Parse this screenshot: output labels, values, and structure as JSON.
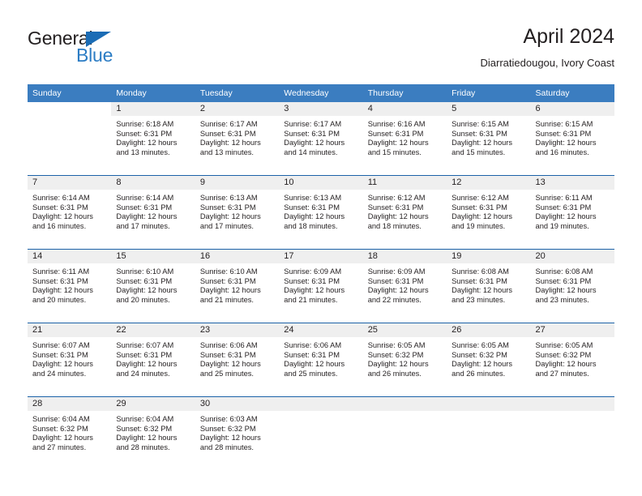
{
  "brand": {
    "name_dark": "General",
    "name_light": "Blue"
  },
  "header": {
    "title": "April 2024",
    "subtitle": "Diarratiedougou, Ivory Coast"
  },
  "colors": {
    "header_blue": "#3b7dc0",
    "rule_blue": "#1b62a8",
    "daynum_band": "#efefef",
    "logo_blue": "#2b7cc4",
    "text": "#231f20"
  },
  "weekday_headers": [
    "Sunday",
    "Monday",
    "Tuesday",
    "Wednesday",
    "Thursday",
    "Friday",
    "Saturday"
  ],
  "weeks": [
    [
      {
        "day": "",
        "lines": []
      },
      {
        "day": "1",
        "lines": [
          "Sunrise: 6:18 AM",
          "Sunset: 6:31 PM",
          "Daylight: 12 hours",
          "and 13 minutes."
        ]
      },
      {
        "day": "2",
        "lines": [
          "Sunrise: 6:17 AM",
          "Sunset: 6:31 PM",
          "Daylight: 12 hours",
          "and 13 minutes."
        ]
      },
      {
        "day": "3",
        "lines": [
          "Sunrise: 6:17 AM",
          "Sunset: 6:31 PM",
          "Daylight: 12 hours",
          "and 14 minutes."
        ]
      },
      {
        "day": "4",
        "lines": [
          "Sunrise: 6:16 AM",
          "Sunset: 6:31 PM",
          "Daylight: 12 hours",
          "and 15 minutes."
        ]
      },
      {
        "day": "5",
        "lines": [
          "Sunrise: 6:15 AM",
          "Sunset: 6:31 PM",
          "Daylight: 12 hours",
          "and 15 minutes."
        ]
      },
      {
        "day": "6",
        "lines": [
          "Sunrise: 6:15 AM",
          "Sunset: 6:31 PM",
          "Daylight: 12 hours",
          "and 16 minutes."
        ]
      }
    ],
    [
      {
        "day": "7",
        "lines": [
          "Sunrise: 6:14 AM",
          "Sunset: 6:31 PM",
          "Daylight: 12 hours",
          "and 16 minutes."
        ]
      },
      {
        "day": "8",
        "lines": [
          "Sunrise: 6:14 AM",
          "Sunset: 6:31 PM",
          "Daylight: 12 hours",
          "and 17 minutes."
        ]
      },
      {
        "day": "9",
        "lines": [
          "Sunrise: 6:13 AM",
          "Sunset: 6:31 PM",
          "Daylight: 12 hours",
          "and 17 minutes."
        ]
      },
      {
        "day": "10",
        "lines": [
          "Sunrise: 6:13 AM",
          "Sunset: 6:31 PM",
          "Daylight: 12 hours",
          "and 18 minutes."
        ]
      },
      {
        "day": "11",
        "lines": [
          "Sunrise: 6:12 AM",
          "Sunset: 6:31 PM",
          "Daylight: 12 hours",
          "and 18 minutes."
        ]
      },
      {
        "day": "12",
        "lines": [
          "Sunrise: 6:12 AM",
          "Sunset: 6:31 PM",
          "Daylight: 12 hours",
          "and 19 minutes."
        ]
      },
      {
        "day": "13",
        "lines": [
          "Sunrise: 6:11 AM",
          "Sunset: 6:31 PM",
          "Daylight: 12 hours",
          "and 19 minutes."
        ]
      }
    ],
    [
      {
        "day": "14",
        "lines": [
          "Sunrise: 6:11 AM",
          "Sunset: 6:31 PM",
          "Daylight: 12 hours",
          "and 20 minutes."
        ]
      },
      {
        "day": "15",
        "lines": [
          "Sunrise: 6:10 AM",
          "Sunset: 6:31 PM",
          "Daylight: 12 hours",
          "and 20 minutes."
        ]
      },
      {
        "day": "16",
        "lines": [
          "Sunrise: 6:10 AM",
          "Sunset: 6:31 PM",
          "Daylight: 12 hours",
          "and 21 minutes."
        ]
      },
      {
        "day": "17",
        "lines": [
          "Sunrise: 6:09 AM",
          "Sunset: 6:31 PM",
          "Daylight: 12 hours",
          "and 21 minutes."
        ]
      },
      {
        "day": "18",
        "lines": [
          "Sunrise: 6:09 AM",
          "Sunset: 6:31 PM",
          "Daylight: 12 hours",
          "and 22 minutes."
        ]
      },
      {
        "day": "19",
        "lines": [
          "Sunrise: 6:08 AM",
          "Sunset: 6:31 PM",
          "Daylight: 12 hours",
          "and 23 minutes."
        ]
      },
      {
        "day": "20",
        "lines": [
          "Sunrise: 6:08 AM",
          "Sunset: 6:31 PM",
          "Daylight: 12 hours",
          "and 23 minutes."
        ]
      }
    ],
    [
      {
        "day": "21",
        "lines": [
          "Sunrise: 6:07 AM",
          "Sunset: 6:31 PM",
          "Daylight: 12 hours",
          "and 24 minutes."
        ]
      },
      {
        "day": "22",
        "lines": [
          "Sunrise: 6:07 AM",
          "Sunset: 6:31 PM",
          "Daylight: 12 hours",
          "and 24 minutes."
        ]
      },
      {
        "day": "23",
        "lines": [
          "Sunrise: 6:06 AM",
          "Sunset: 6:31 PM",
          "Daylight: 12 hours",
          "and 25 minutes."
        ]
      },
      {
        "day": "24",
        "lines": [
          "Sunrise: 6:06 AM",
          "Sunset: 6:31 PM",
          "Daylight: 12 hours",
          "and 25 minutes."
        ]
      },
      {
        "day": "25",
        "lines": [
          "Sunrise: 6:05 AM",
          "Sunset: 6:32 PM",
          "Daylight: 12 hours",
          "and 26 minutes."
        ]
      },
      {
        "day": "26",
        "lines": [
          "Sunrise: 6:05 AM",
          "Sunset: 6:32 PM",
          "Daylight: 12 hours",
          "and 26 minutes."
        ]
      },
      {
        "day": "27",
        "lines": [
          "Sunrise: 6:05 AM",
          "Sunset: 6:32 PM",
          "Daylight: 12 hours",
          "and 27 minutes."
        ]
      }
    ],
    [
      {
        "day": "28",
        "lines": [
          "Sunrise: 6:04 AM",
          "Sunset: 6:32 PM",
          "Daylight: 12 hours",
          "and 27 minutes."
        ]
      },
      {
        "day": "29",
        "lines": [
          "Sunrise: 6:04 AM",
          "Sunset: 6:32 PM",
          "Daylight: 12 hours",
          "and 28 minutes."
        ]
      },
      {
        "day": "30",
        "lines": [
          "Sunrise: 6:03 AM",
          "Sunset: 6:32 PM",
          "Daylight: 12 hours",
          "and 28 minutes."
        ]
      },
      {
        "day": "",
        "lines": []
      },
      {
        "day": "",
        "lines": []
      },
      {
        "day": "",
        "lines": []
      },
      {
        "day": "",
        "lines": []
      }
    ]
  ]
}
